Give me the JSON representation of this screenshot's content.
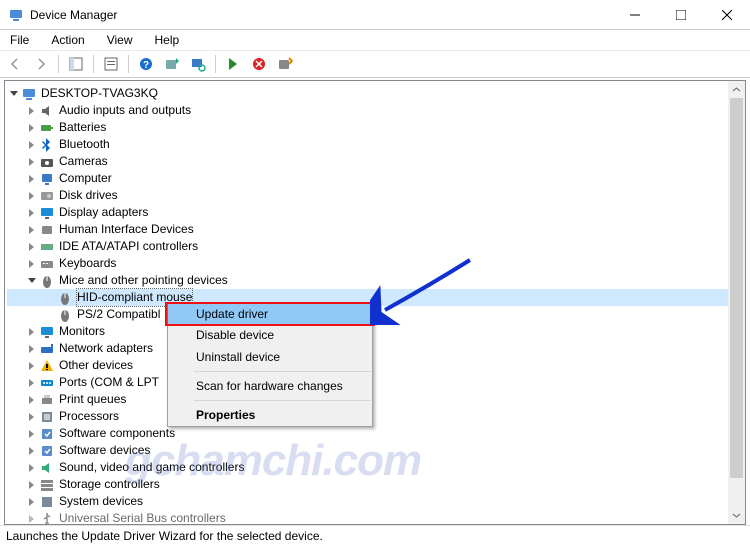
{
  "window": {
    "title": "Device Manager"
  },
  "menu": {
    "file": "File",
    "action": "Action",
    "view": "View",
    "help": "Help"
  },
  "tree": {
    "root": "DESKTOP-TVAG3KQ",
    "cat0": "Audio inputs and outputs",
    "cat1": "Batteries",
    "cat2": "Bluetooth",
    "cat3": "Cameras",
    "cat4": "Computer",
    "cat5": "Disk drives",
    "cat6": "Display adapters",
    "cat7": "Human Interface Devices",
    "cat8": "IDE ATA/ATAPI controllers",
    "cat9": "Keyboards",
    "cat10": "Mice and other pointing devices",
    "cat10a": "HID-compliant mouse",
    "cat10b": "PS/2 Compatibl",
    "cat11": "Monitors",
    "cat12": "Network adapters",
    "cat13": "Other devices",
    "cat14": "Ports (COM & LPT",
    "cat15": "Print queues",
    "cat16": "Processors",
    "cat17": "Software components",
    "cat18": "Software devices",
    "cat19": "Sound, video and game controllers",
    "cat20": "Storage controllers",
    "cat21": "System devices",
    "cat22": "Universal Serial Bus controllers"
  },
  "context_menu": {
    "update": "Update driver",
    "disable": "Disable device",
    "uninstall": "Uninstall device",
    "scan": "Scan for hardware changes",
    "props": "Properties"
  },
  "status": "Launches the Update Driver Wizard for the selected device.",
  "watermark": "gchamchi.com"
}
